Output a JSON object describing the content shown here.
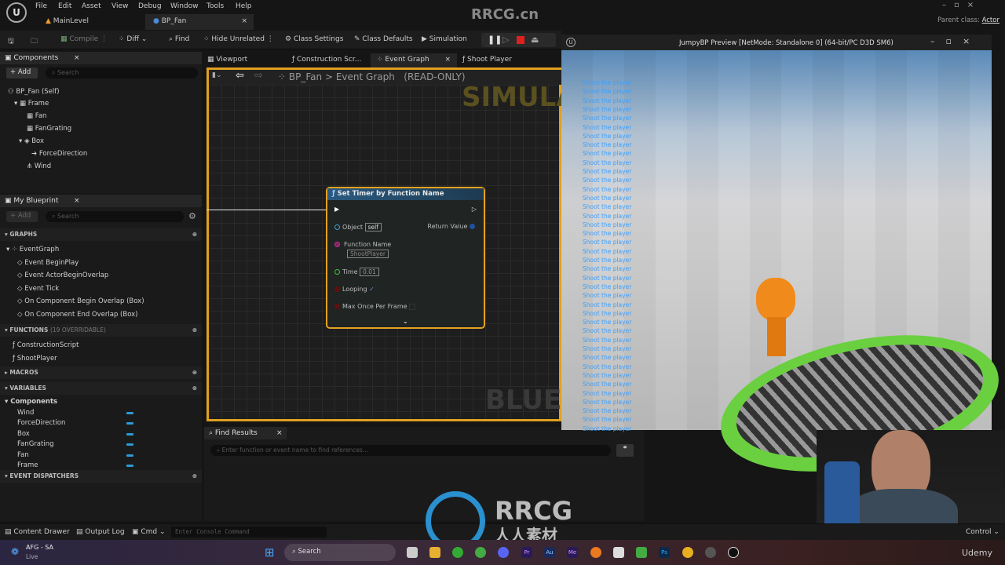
{
  "menu": [
    "File",
    "Edit",
    "Asset",
    "View",
    "Debug",
    "Window",
    "Tools",
    "Help"
  ],
  "watermark_top": "RRCG.cn",
  "doc_tabs": [
    {
      "label": "MainLevel"
    },
    {
      "label": "BP_Fan",
      "close": "×"
    }
  ],
  "parent_class": {
    "label": "Parent class:",
    "value": "Actor"
  },
  "toolbar": {
    "compile": "Compile",
    "diff": "Diff",
    "find": "Find",
    "hide_unrelated": "Hide Unrelated",
    "class_settings": "Class Settings",
    "class_defaults": "Class Defaults",
    "simulation": "Simulation"
  },
  "components": {
    "title": "Components",
    "add": "+ Add",
    "search_placeholder": "Search",
    "tree": [
      "BP_Fan (Self)",
      "Frame",
      "Fan",
      "FanGrating",
      "Box",
      "ForceDirection",
      "Wind"
    ]
  },
  "my_blueprint": {
    "title": "My Blueprint",
    "add": "+ Add",
    "search_placeholder": "Search",
    "graphs_label": "GRAPHS",
    "graphs": [
      "EventGraph",
      "Event BeginPlay",
      "Event ActorBeginOverlap",
      "Event Tick",
      "On Component Begin Overlap (Box)",
      "On Component End Overlap (Box)"
    ],
    "functions_label": "FUNCTIONS",
    "functions_note": "(19 OVERRIDABLE)",
    "functions": [
      "ConstructionScript",
      "ShootPlayer"
    ],
    "macros_label": "MACROS",
    "variables_label": "VARIABLES",
    "components_label": "Components",
    "variables": [
      "Wind",
      "ForceDirection",
      "Box",
      "FanGrating",
      "Fan",
      "Frame"
    ],
    "dispatchers_label": "EVENT DISPATCHERS"
  },
  "graph_tabs": [
    "Viewport",
    "Construction Scr...",
    "Event Graph",
    "Shoot Player"
  ],
  "breadcrumb": {
    "bp": "BP_Fan",
    "sep": ">",
    "graph": "Event Graph",
    "mode": "(READ-ONLY)"
  },
  "graph_watermarks": {
    "top": "SIMULA",
    "bottom": "BLUEP"
  },
  "node": {
    "title": "Set Timer by Function Name",
    "object_label": "Object",
    "object_value": "self",
    "return_label": "Return Value",
    "function_label": "Function Name",
    "function_value": "ShootPlayer",
    "time_label": "Time",
    "time_value": "0.01",
    "looping_label": "Looping",
    "looping_checked": true,
    "max_label": "Max Once Per Frame"
  },
  "find_results": {
    "title": "Find Results",
    "placeholder": "Enter function or event name to find references..."
  },
  "preview": {
    "title": "JumpyBP Preview [NetMode: Standalone 0]  (64-bit/PC D3D SM6)",
    "message": "Shoot the player",
    "message_count": 40
  },
  "status": {
    "content_drawer": "Content Drawer",
    "output_log": "Output Log",
    "cmd": "Cmd",
    "console_placeholder": "Enter Console Command",
    "control": "Control"
  },
  "taskbar": {
    "weather_title": "AFG - SA",
    "weather_sub": "Live",
    "search": "Search",
    "apps": [
      "Pr",
      "Au",
      "Me",
      "Ps"
    ],
    "udemy": "Udemy"
  },
  "watermark_bottom": {
    "brand": "RRCG",
    "sub": "人人素材"
  }
}
